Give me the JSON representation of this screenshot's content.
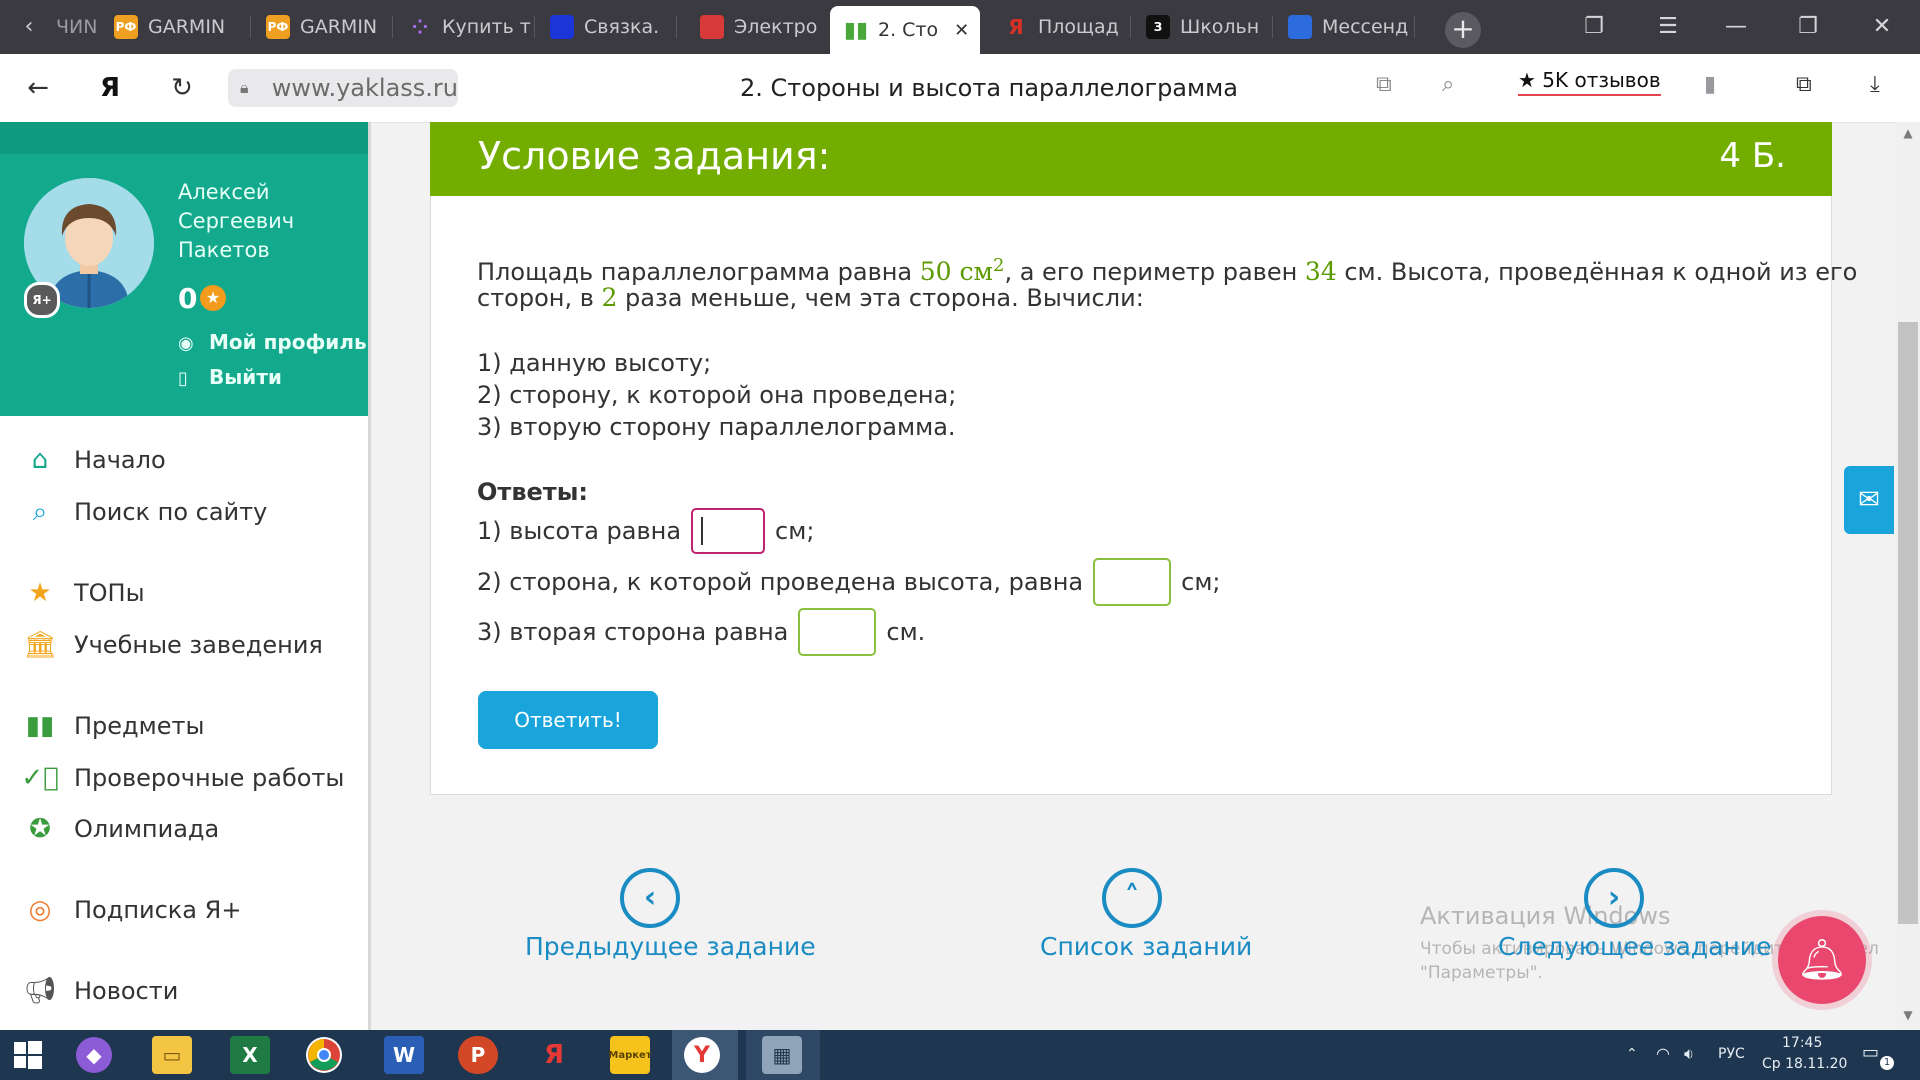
{
  "browser": {
    "tab_fragment": "ЧИN",
    "tabs": [
      {
        "label": "GARMIN",
        "icon": "rf-icon",
        "fav_text": "РФ",
        "fav_color": "#f0a020"
      },
      {
        "label": "GARMIN",
        "icon": "rf-icon",
        "fav_text": "РФ",
        "fav_color": "#f0a020"
      },
      {
        "label": "Купить т",
        "icon": "dots-icon",
        "fav_text": "⁘",
        "fav_color": "#7a4fc8"
      },
      {
        "label": "Связка.",
        "icon": "cube-icon",
        "fav_text": "",
        "fav_color": "#1c35d6"
      },
      {
        "label": "Электро",
        "icon": "puzzle-icon",
        "fav_text": "",
        "fav_color": "#d83a3a"
      },
      {
        "label": "2. Сто",
        "icon": "book-icon",
        "fav_text": "",
        "fav_color": "#4aa83a"
      },
      {
        "label": "Площад",
        "icon": "yandex-icon",
        "fav_text": "Я",
        "fav_color": "#d93025"
      },
      {
        "label": "Школьн",
        "icon": "znanija-icon",
        "fav_text": "З",
        "fav_color": "#111111"
      },
      {
        "label": "Мессенд",
        "icon": "chat-icon",
        "fav_text": "",
        "fav_color": "#2d6cdf"
      }
    ],
    "active_tab_close": "✕",
    "url": "www.yaklass.ru",
    "page_title": "2. Стороны и высота параллелограмма",
    "reviews": "★ 5K отзывов"
  },
  "sidebar": {
    "name_line1": "Алексей",
    "name_line2": "Сергеевич",
    "name_line3": "Пакетов",
    "avatar_badge": "Я+",
    "points": "0",
    "profile_link": "Мой профиль",
    "logout_link": "Выйти",
    "menu": [
      {
        "label": "Начало",
        "icon": "home-icon"
      },
      {
        "label": "Поиск по сайту",
        "icon": "search-icon"
      },
      {
        "label": "ТОПы",
        "icon": "star-icon"
      },
      {
        "label": "Учебные заведения",
        "icon": "institution-icon"
      },
      {
        "label": "Предметы",
        "icon": "books-icon"
      },
      {
        "label": "Проверочные работы",
        "icon": "check-circle-icon"
      },
      {
        "label": "Олимпиада",
        "icon": "medal-icon"
      },
      {
        "label": "Подписка Я+",
        "icon": "subscription-icon"
      },
      {
        "label": "Новости",
        "icon": "megaphone-icon"
      }
    ]
  },
  "task": {
    "title": "Условие задания:",
    "score": "4 Б.",
    "p1_a": "Площадь параллелограмма равна ",
    "p1_area": "50",
    "p1_unit": " см",
    "p1_sup": "2",
    "p1_b": ", а его периметр равен ",
    "p1_perim": "34",
    "p1_c": " см. Высота, проведённая к одной из его",
    "p2_a": "сторон, в ",
    "p2_ratio": "2",
    "p2_b": " раза меньше, чем эта сторона. Вычисли:",
    "item1": "1) данную высоту;",
    "item2": "2) сторону, к которой она проведена;",
    "item3": "3) вторую сторону параллелограмма.",
    "answers_title": "Ответы:",
    "ans1_label": "1) высота равна",
    "ans1_unit": "см;",
    "ans2_label": "2) сторона, к которой проведена высота, равна",
    "ans2_unit": "см;",
    "ans3_label": "3) вторая сторона равна",
    "ans3_unit": "см.",
    "ans1_value": "",
    "ans2_value": "",
    "ans3_value": "",
    "submit": "Ответить!"
  },
  "bottom_nav": {
    "prev": "Предыдущее задание",
    "list": "Список заданий",
    "next": "Следующее задание"
  },
  "watermark": {
    "line1": "Активация Windows",
    "line2": "Чтобы активировать Windows, перейдите в раздел",
    "line3": "\"Параметры\"."
  },
  "taskbar": {
    "lang": "РУС",
    "time": "17:45",
    "date": "Ср 18.11.20",
    "notifications": "1"
  },
  "colors": {
    "header_green": "#72ad00",
    "sidebar_teal": "#13a98c",
    "link_blue": "#1a8bc3",
    "button_blue": "#1aa4dc",
    "active_input_border": "#c0246f"
  }
}
